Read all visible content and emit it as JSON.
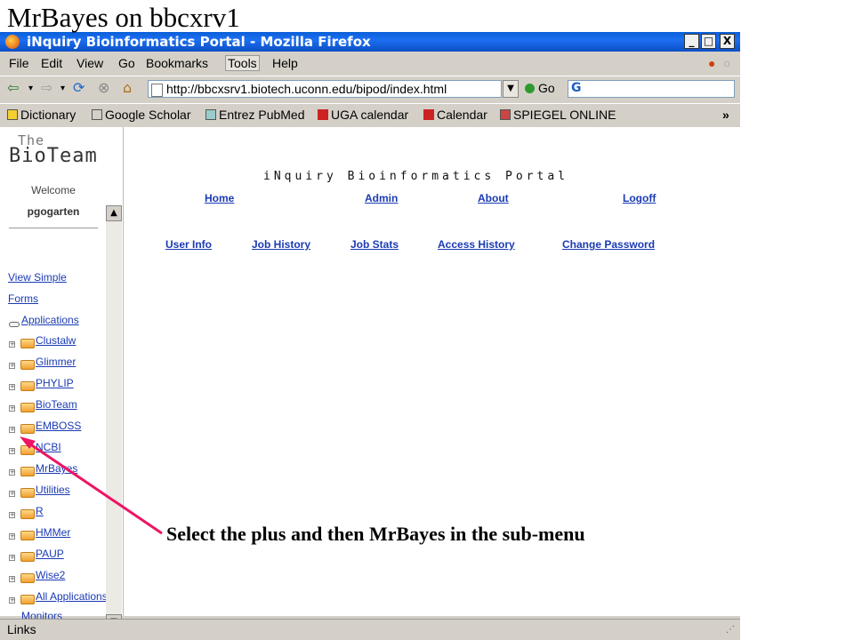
{
  "slide": {
    "title": "MrBayes on bbcxrv1",
    "annotation": "Select the plus and then MrBayes in the sub-menu",
    "arrow_color": "#ee1464"
  },
  "window": {
    "title": "iNquiry Bioinformatics Portal - Mozilla Firefox",
    "title_bar_color": "#1d6ff2",
    "controls": [
      "_",
      "□",
      "X"
    ]
  },
  "menu": {
    "items": [
      "File",
      "Edit",
      "View",
      "Go",
      "Bookmarks",
      "Tools",
      "Help"
    ]
  },
  "navbar": {
    "url": "http://bbcxsrv1.biotech.uconn.edu/bipod/index.html",
    "go_label": "Go",
    "search_engine_icon": "G",
    "icons": [
      "back-icon",
      "forward-icon",
      "reload-icon",
      "stop-icon",
      "home-icon"
    ]
  },
  "bookmarks": {
    "items": [
      "Dictionary",
      "Google Scholar",
      "Entrez PubMed",
      "UGA calendar",
      "Calendar",
      "SPIEGEL ONLINE"
    ],
    "overflow": "»"
  },
  "left_frame": {
    "logo_the": "The",
    "logo_main": "BioTeam",
    "welcome": "Welcome",
    "username": "pgogarten",
    "view_simple": "View Simple",
    "forms": "Forms",
    "applications": "Applications",
    "tree": [
      "Clustalw",
      "Glimmer",
      "PHYLIP",
      "BioTeam",
      "EMBOSS",
      "NCBI",
      "MrBayes",
      "Utilities",
      "R",
      "HMMer",
      "PAUP",
      "Wise2",
      "All Applications"
    ],
    "monitors": "Monitors"
  },
  "portal": {
    "title": "iNquiry   Bioinformatics   Portal",
    "top_links": [
      "Home",
      "Admin",
      "About",
      "Logoff"
    ],
    "sub_links": [
      "User Info",
      "Job History",
      "Job Stats",
      "Access History",
      "Change Password"
    ]
  },
  "status": {
    "text": "Links"
  }
}
